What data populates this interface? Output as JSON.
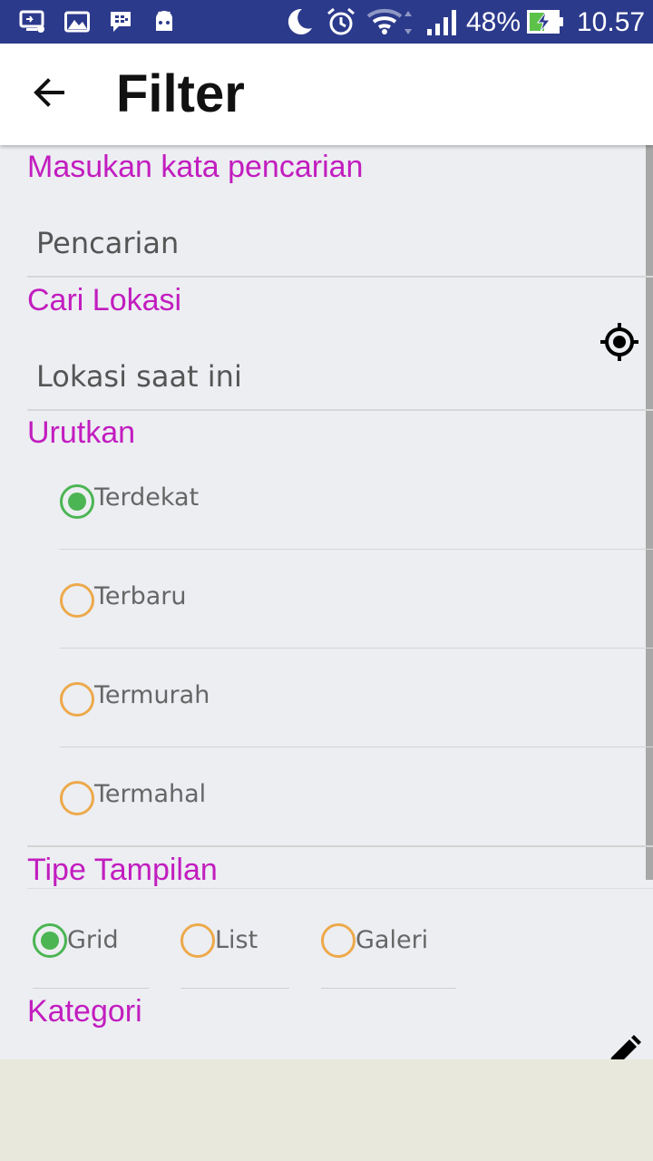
{
  "status_bar": {
    "battery": "48%",
    "time": "10.57",
    "icons": [
      "screen-cast-icon",
      "image-icon",
      "bbm-icon",
      "android-icon",
      "moon-icon",
      "alarm-icon",
      "wifi-icon",
      "signal-icon",
      "battery-charging-icon"
    ]
  },
  "app_bar": {
    "title": "Filter",
    "back_icon": "arrow-left-icon"
  },
  "search": {
    "label": "Masukan kata pencarian",
    "placeholder": "Pencarian",
    "value": ""
  },
  "location": {
    "label": "Cari Lokasi",
    "placeholder": "Lokasi saat ini",
    "value": "",
    "action_icon": "my-location-icon"
  },
  "sort": {
    "label": "Urutkan",
    "options": [
      {
        "label": "Terdekat",
        "checked": true
      },
      {
        "label": "Terbaru",
        "checked": false
      },
      {
        "label": "Termurah",
        "checked": false
      },
      {
        "label": "Termahal",
        "checked": false
      }
    ]
  },
  "view_type": {
    "label": "Tipe Tampilan",
    "options": [
      {
        "label": "Grid",
        "checked": true
      },
      {
        "label": "List",
        "checked": false
      },
      {
        "label": "Galeri",
        "checked": false
      }
    ]
  },
  "category": {
    "label": "Kategori",
    "action_icon": "pencil-icon"
  },
  "colors": {
    "status_bar": "#2c3a8c",
    "accent_label": "#c21dbf",
    "radio_checked": "#4bb553",
    "radio_unchecked": "#eda94a",
    "content_bg": "#eceef2"
  }
}
